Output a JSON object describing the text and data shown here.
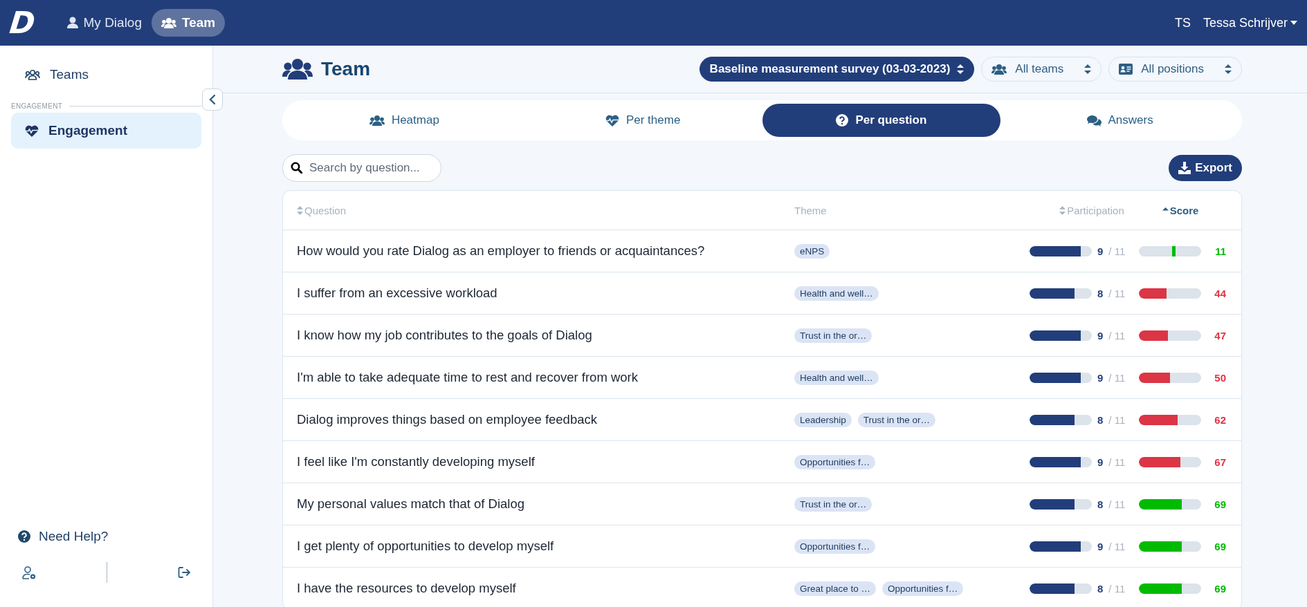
{
  "topbar": {
    "logo": "D",
    "nav": [
      {
        "label": "My Dialog",
        "selected": false
      },
      {
        "label": "Team",
        "selected": true
      }
    ],
    "user_initials": "TS",
    "user_name": "Tessa Schrijver"
  },
  "sidebar": {
    "items": [
      {
        "label": "Teams",
        "selected": false
      }
    ],
    "section": "ENGAGEMENT",
    "section_items": [
      {
        "label": "Engagement",
        "selected": true
      }
    ],
    "help": "Need Help?"
  },
  "page": {
    "title": "Team",
    "survey": "Baseline measurement survey (03-03-2023)",
    "team_filter": "All teams",
    "position_filter": "All positions"
  },
  "tabs": [
    {
      "label": "Heatmap",
      "selected": false
    },
    {
      "label": "Per theme",
      "selected": false
    },
    {
      "label": "Per question",
      "selected": true
    },
    {
      "label": "Answers",
      "selected": false
    }
  ],
  "search": {
    "placeholder": "Search by question..."
  },
  "export": "Export",
  "table": {
    "columns": [
      {
        "label": "Question",
        "sortable": true,
        "sorted": false
      },
      {
        "label": "Theme",
        "sortable": false,
        "sorted": false
      },
      {
        "label": "Participation",
        "sortable": true,
        "sorted": false
      },
      {
        "label": "Score",
        "sortable": true,
        "sorted": true
      }
    ],
    "rows": [
      {
        "question": "How would you rate Dialog as an employer to friends or acquaintances?",
        "themes": [
          "eNPS"
        ],
        "participation": {
          "count": "9",
          "total": "/ 11",
          "level": 0.818
        },
        "score": {
          "kind": "marker",
          "level": 0.555,
          "value": "11",
          "color": "#00bb00"
        }
      },
      {
        "question": "I suffer from an excessive workload",
        "themes": [
          "Health and well…"
        ],
        "participation": {
          "count": "8",
          "total": "/ 11",
          "level": 0.727
        },
        "score": {
          "kind": "fill",
          "level": 0.44,
          "value": "44",
          "color": "#dc3545"
        }
      },
      {
        "question": "I know how my job contributes to the goals of Dialog",
        "themes": [
          "Trust in the or…"
        ],
        "participation": {
          "count": "9",
          "total": "/ 11",
          "level": 0.818
        },
        "score": {
          "kind": "fill",
          "level": 0.47,
          "value": "47",
          "color": "#dc3545"
        }
      },
      {
        "question": "I'm able to take adequate time to rest and recover from work",
        "themes": [
          "Health and well…"
        ],
        "participation": {
          "count": "9",
          "total": "/ 11",
          "level": 0.818
        },
        "score": {
          "kind": "fill",
          "level": 0.5,
          "value": "50",
          "color": "#dc3545"
        }
      },
      {
        "question": "Dialog improves things based on employee feedback",
        "themes": [
          "Leadership",
          "Trust in the or…"
        ],
        "participation": {
          "count": "8",
          "total": "/ 11",
          "level": 0.727
        },
        "score": {
          "kind": "fill",
          "level": 0.62,
          "value": "62",
          "color": "#dc3545"
        }
      },
      {
        "question": "I feel like I'm constantly developing myself",
        "themes": [
          "Opportunities f…"
        ],
        "participation": {
          "count": "9",
          "total": "/ 11",
          "level": 0.818
        },
        "score": {
          "kind": "fill",
          "level": 0.67,
          "value": "67",
          "color": "#dc3545"
        }
      },
      {
        "question": "My personal values match that of Dialog",
        "themes": [
          "Trust in the or…"
        ],
        "participation": {
          "count": "8",
          "total": "/ 11",
          "level": 0.727
        },
        "score": {
          "kind": "fill",
          "level": 0.69,
          "value": "69",
          "color": "#00bb00"
        }
      },
      {
        "question": "I get plenty of opportunities to develop myself",
        "themes": [
          "Opportunities f…"
        ],
        "participation": {
          "count": "9",
          "total": "/ 11",
          "level": 0.818
        },
        "score": {
          "kind": "fill",
          "level": 0.69,
          "value": "69",
          "color": "#00bb00"
        }
      },
      {
        "question": "I have the resources to develop myself",
        "themes": [
          "Great place to …",
          "Opportunities f…"
        ],
        "participation": {
          "count": "8",
          "total": "/ 11",
          "level": 0.727
        },
        "score": {
          "kind": "fill",
          "level": 0.69,
          "value": "69",
          "color": "#00bb00"
        }
      }
    ]
  }
}
